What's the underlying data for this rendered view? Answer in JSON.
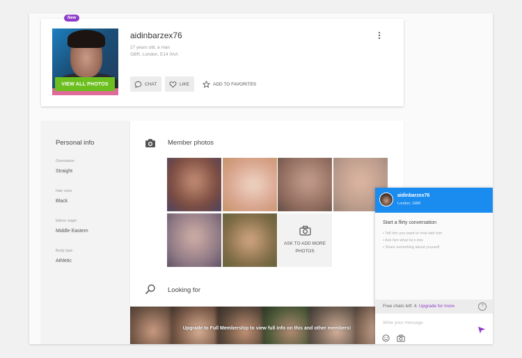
{
  "profile": {
    "badge": "New",
    "username": "aidinbarzex76",
    "age_line": "27 years old, a man",
    "location": "GBR, London, E14 0AA",
    "view_photos_label": "VIEW ALL PHOTOS",
    "actions": {
      "chat": "CHAT",
      "like": "LIKE",
      "favorites": "ADD TO FAVORITES"
    }
  },
  "info": {
    "title": "Personal info",
    "fields": [
      {
        "label": "Orientation",
        "value": "Straight"
      },
      {
        "label": "Hair color",
        "value": "Black"
      },
      {
        "label": "Ethnic origin",
        "value": "Middle Eastern"
      },
      {
        "label": "Body type",
        "value": "Athletic"
      }
    ]
  },
  "photos": {
    "title": "Member photos",
    "ask_label_1": "ASK TO ADD MORE",
    "ask_label_2": "PHOTOS",
    "tile_colors": [
      "#7a4a3e",
      "#d8a38c",
      "#8e6a5c",
      "#b99a8a",
      "#8c7784",
      "#7d6a45"
    ]
  },
  "looking": {
    "title": "Looking for",
    "overlay_text": "Upgrade to Full Membership to view full info on this and other members!"
  },
  "chat": {
    "name": "aidinbarzex76",
    "location": "London, GBR",
    "start_title": "Start a flirty conversation",
    "tips": [
      "Tell him you want to chat with him",
      "Ask him what he's into",
      "Share something about yourself"
    ],
    "free_chats_text": "Free chats left: 4.",
    "upgrade_text": "Upgrade for more",
    "help": "?",
    "placeholder": "Write your message"
  },
  "colors": {
    "accent_blue": "#1a8cf0",
    "accent_purple": "#8e3cc9",
    "accent_green": "#6cbf1e"
  }
}
